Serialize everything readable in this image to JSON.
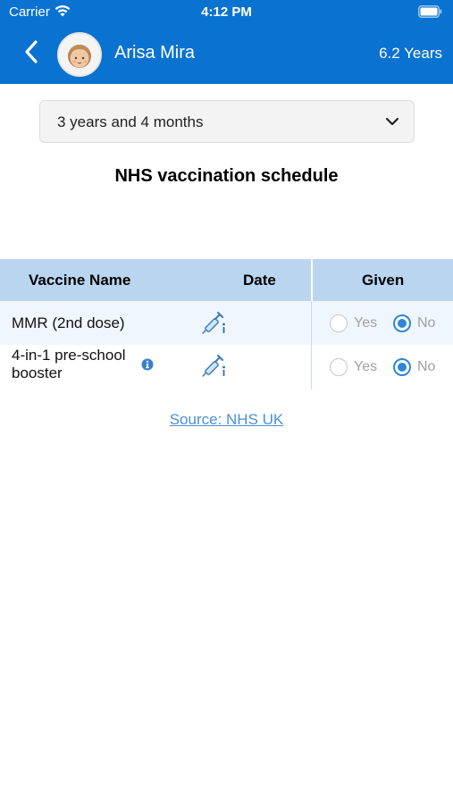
{
  "status_bar": {
    "carrier": "Carrier",
    "time": "4:12 PM",
    "wifi_icon": "wifi-icon",
    "battery_icon": "battery-icon"
  },
  "nav": {
    "back_icon": "chevron-left-icon",
    "child_name": "Arisa Mira",
    "child_age": "6.2 Years",
    "brand_color": "#0a72d0"
  },
  "age_selector": {
    "value": "3 years and 4 months",
    "icon": "chevron-down-icon"
  },
  "title": "NHS vaccination schedule",
  "table": {
    "headers": {
      "name": "Vaccine Name",
      "date": "Date",
      "given": "Given"
    },
    "rows": [
      {
        "name": "MMR (2nd dose)",
        "date_icon": "syringe-icon",
        "info": false,
        "yes_label": "Yes",
        "no_label": "No",
        "given": "No"
      },
      {
        "name": "4-in-1 pre-school booster",
        "date_icon": "syringe-icon",
        "info": true,
        "yes_label": "Yes",
        "no_label": "No",
        "given": "No"
      }
    ]
  },
  "source_link": "Source: NHS UK"
}
